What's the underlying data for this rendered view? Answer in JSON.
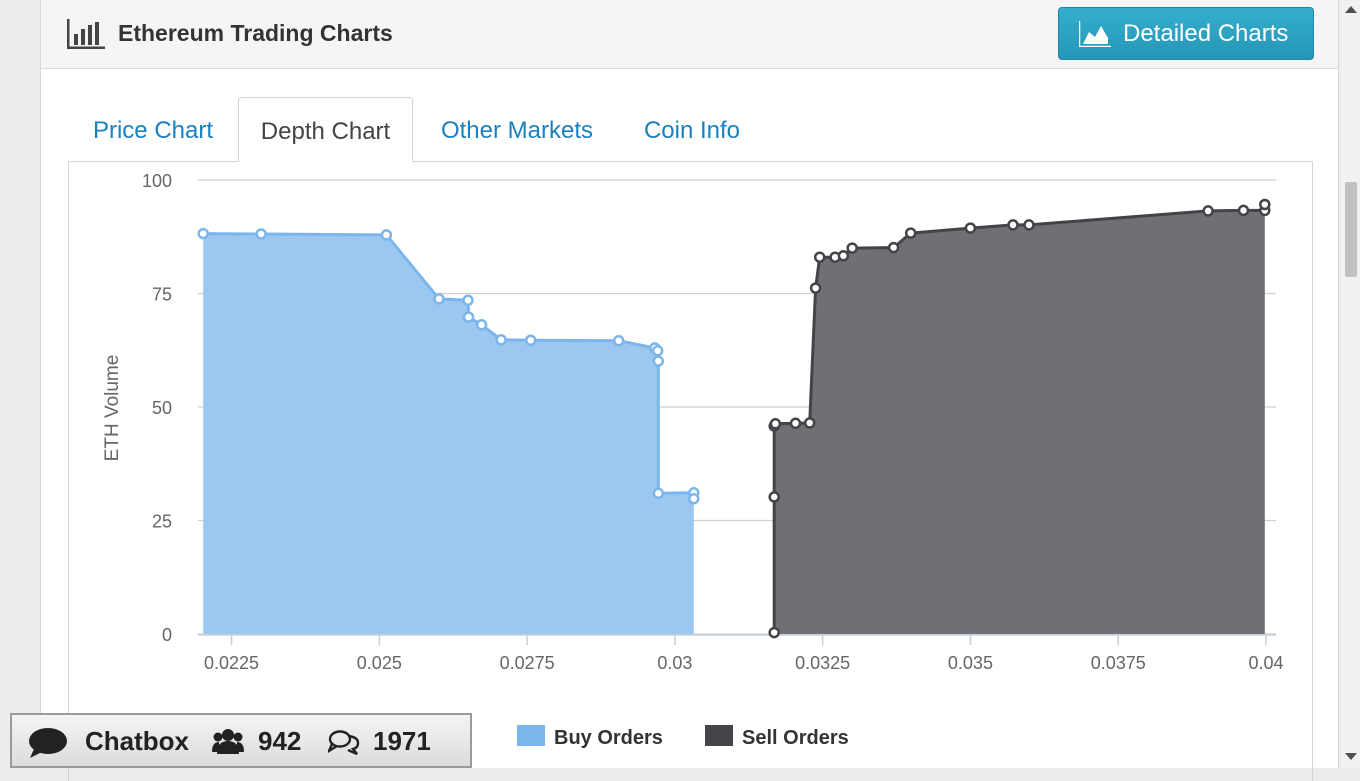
{
  "header": {
    "title": "Ethereum Trading Charts",
    "detailed_charts_label": "Detailed Charts",
    "icon": "bar-chart-icon",
    "button_icon": "area-chart-icon"
  },
  "tabs": [
    {
      "label": "Price Chart",
      "active": false
    },
    {
      "label": "Depth Chart",
      "active": true
    },
    {
      "label": "Other Markets",
      "active": false
    },
    {
      "label": "Coin Info",
      "active": false
    }
  ],
  "chatbox": {
    "label": "Chatbox",
    "users_count": "942",
    "messages_count": "1971",
    "icons": [
      "chat-bubble-icon",
      "users-icon",
      "comments-icon"
    ]
  },
  "colors": {
    "accent": "#2a9fc2",
    "tab_link": "#1a80c0",
    "buy_fill": "#9cc7f0",
    "buy_stroke": "#7cb5ec",
    "sell_fill": "#706f75",
    "sell_stroke": "#434348"
  },
  "chart_data": {
    "type": "area",
    "ylabel": "ETH Volume",
    "xlabel": "",
    "title": "",
    "ylim": [
      0,
      100
    ],
    "xlim": [
      0.022,
      0.04
    ],
    "y_ticks": [
      "0",
      "25",
      "50",
      "75",
      "100"
    ],
    "x_ticks": [
      "0.0225",
      "0.025",
      "0.0275",
      "0.03",
      "0.0325",
      "0.035",
      "0.0375",
      "0.04"
    ],
    "legend_position": "bottom-center",
    "series": [
      {
        "name": "Buy Orders",
        "color": "#7cb5ec",
        "points": [
          [
            0.02202,
            88.2
          ],
          [
            0.023,
            88.1
          ],
          [
            0.02512,
            87.9
          ],
          [
            0.02601,
            73.8
          ],
          [
            0.0265,
            73.5
          ],
          [
            0.02651,
            69.8
          ],
          [
            0.02673,
            68.1
          ],
          [
            0.02706,
            64.8
          ],
          [
            0.02756,
            64.7
          ],
          [
            0.02905,
            64.6
          ],
          [
            0.02966,
            63.0
          ],
          [
            0.02971,
            62.4
          ],
          [
            0.02972,
            60.1
          ],
          [
            0.02972,
            31.0
          ],
          [
            0.03032,
            31.1
          ],
          [
            0.03032,
            29.8
          ]
        ]
      },
      {
        "name": "Sell Orders",
        "color": "#434348",
        "points": [
          [
            0.03168,
            0.3
          ],
          [
            0.03168,
            30.2
          ],
          [
            0.03168,
            45.8
          ],
          [
            0.0317,
            46.3
          ],
          [
            0.03204,
            46.4
          ],
          [
            0.03228,
            46.5
          ],
          [
            0.03238,
            76.2
          ],
          [
            0.03245,
            83.0
          ],
          [
            0.03271,
            83.0
          ],
          [
            0.03285,
            83.3
          ],
          [
            0.033,
            85.0
          ],
          [
            0.0337,
            85.1
          ],
          [
            0.03399,
            88.3
          ],
          [
            0.035,
            89.4
          ],
          [
            0.03572,
            90.1
          ],
          [
            0.03599,
            90.1
          ],
          [
            0.03902,
            93.2
          ],
          [
            0.03962,
            93.3
          ],
          [
            0.03998,
            93.3
          ],
          [
            0.03998,
            94.6
          ]
        ]
      }
    ]
  }
}
